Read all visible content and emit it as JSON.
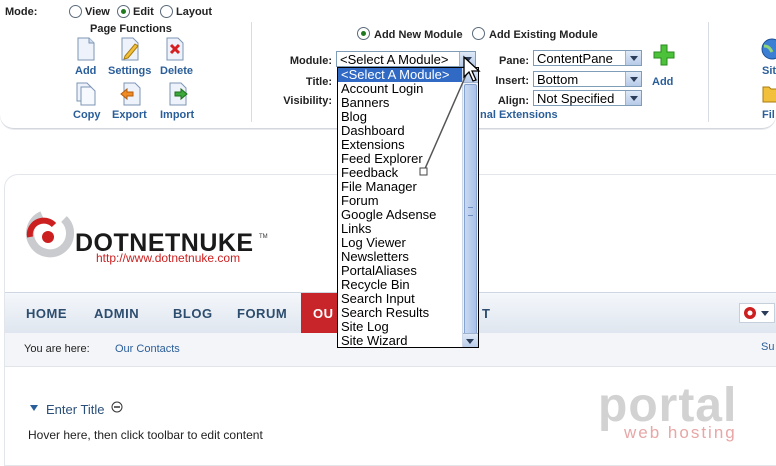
{
  "control_panel": {
    "mode": {
      "label": "Mode:",
      "options": [
        "View",
        "Edit",
        "Layout"
      ],
      "selected": "Edit"
    },
    "page_functions": {
      "title": "Page Functions",
      "items": [
        "Add",
        "Settings",
        "Delete",
        "Copy",
        "Export",
        "Import"
      ]
    },
    "module_source": {
      "options": [
        "Add New Module",
        "Add Existing Module"
      ],
      "selected": "Add New Module"
    },
    "fields": {
      "module_label": "Module:",
      "module_value": "<Select A Module>",
      "title_label": "Title:",
      "visibility_label": "Visibility:",
      "pane_label": "Pane:",
      "pane_value": "ContentPane",
      "insert_label": "Insert:",
      "insert_value": "Bottom",
      "align_label": "Align:",
      "align_value": "Not Specified",
      "add_label": "Add",
      "extensions_link": "nal Extensions"
    },
    "right_partial": {
      "label1": "Sit",
      "label2": "Fil"
    }
  },
  "dropdown_options": [
    "<Select A Module>",
    "Account Login",
    "Banners",
    "Blog",
    "Dashboard",
    "Extensions",
    "Feed Explorer",
    "Feedback",
    "File Manager",
    "Forum",
    "Google Adsense",
    "Links",
    "Log Viewer",
    "Newsletters",
    "PortalAliases",
    "Recycle Bin",
    "Search Input",
    "Search Results",
    "Site Log",
    "Site Wizard"
  ],
  "site": {
    "logo_text": "DOTNETNUKE",
    "logo_tm": "TM",
    "logo_url": "http://www.dotnetnuke.com",
    "nav": [
      "HOME",
      "ADMIN",
      "BLOG",
      "FORUM",
      "OU",
      "T"
    ],
    "breadcrumb_label": "You are here:",
    "breadcrumb_link": "Our Contacts",
    "breadcrumb_right": "Su",
    "module_title": "Enter Title",
    "module_hint": "Hover here, then click toolbar to edit content"
  },
  "watermark": {
    "word": "portal",
    "sub": "web hosting"
  },
  "colors": {
    "link_blue": "#2a5e9a",
    "nav_text": "#2d4d6e",
    "highlight": "#316ac5",
    "dnn_red": "#cc1f1f",
    "nav_active": "#c8252b"
  }
}
